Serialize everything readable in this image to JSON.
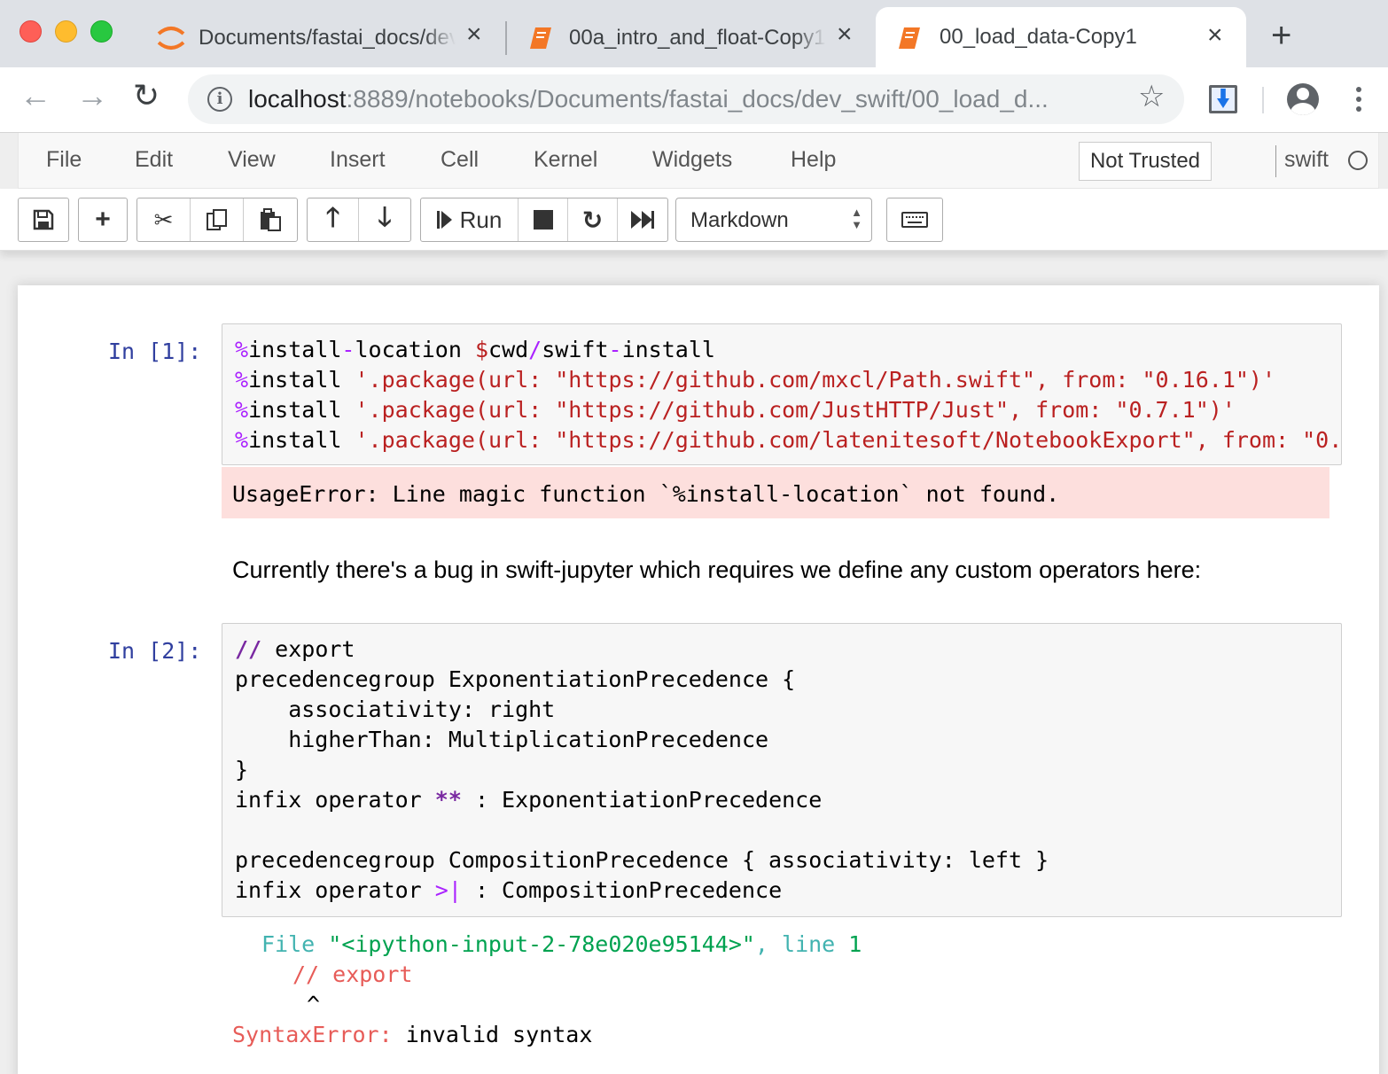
{
  "browser": {
    "tabs": [
      {
        "title": "Documents/fastai_docs/dev_swift/",
        "icon": "jupyter-logo-icon"
      },
      {
        "title": "00a_intro_and_float-Copy1",
        "icon": "notebook-icon"
      },
      {
        "title": "00_load_data-Copy1",
        "icon": "notebook-icon",
        "active": true
      }
    ],
    "url_host": "localhost",
    "url_rest": ":8889/notebooks/Documents/fastai_docs/dev_swift/00_load_d..."
  },
  "jupyter": {
    "menu": [
      "File",
      "Edit",
      "View",
      "Insert",
      "Cell",
      "Kernel",
      "Widgets",
      "Help"
    ],
    "trust_label": "Not Trusted",
    "kernel_name": "swift",
    "run_label": "Run",
    "cell_type": "Markdown"
  },
  "cells": {
    "cell1": {
      "prompt": "In [1]:",
      "error": "UsageError: Line magic function `%install-location` not found."
    },
    "markdown": "Currently there's a bug in swift-jupyter which requires we define any custom operators here:",
    "cell2": {
      "prompt": "In [2]:",
      "traceback_file": "File",
      "traceback_path": "\"<ipython-input-2-78e020e95144>\"",
      "traceback_line_word": ", line",
      "traceback_line_no": "1",
      "traceback_code": "// export",
      "traceback_caret": "^",
      "error_type": "SyntaxError:",
      "error_msg": "invalid syntax"
    }
  },
  "colors": {
    "prompt": "#303f9f",
    "error_bg": "#fddfdd",
    "keyword": "#7928a1",
    "string": "#ba2121"
  }
}
